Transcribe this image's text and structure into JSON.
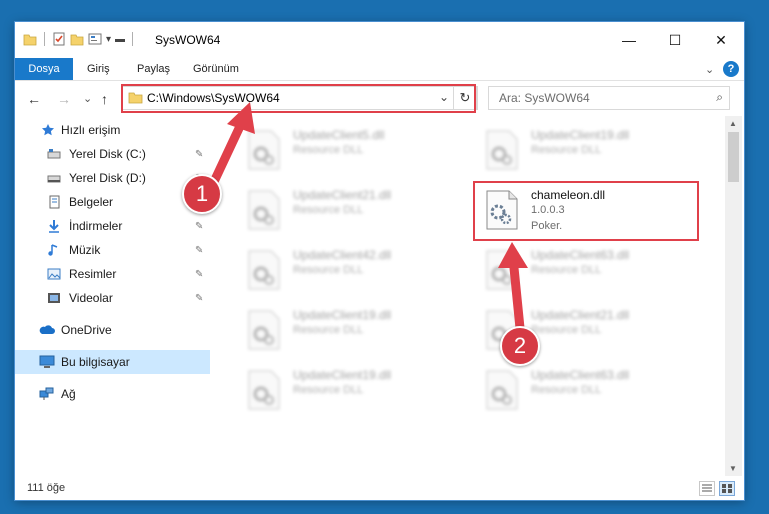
{
  "window": {
    "title": "SysWOW64",
    "qat_dropdown": "▾",
    "controls": {
      "minimize": "—",
      "maximize": "☐",
      "close": "✕"
    }
  },
  "ribbon": {
    "tabs": [
      "Dosya",
      "Giriş",
      "Paylaş",
      "Görünüm"
    ],
    "collapse": "⌄",
    "help": "?"
  },
  "navbar": {
    "back": "←",
    "forward": "→",
    "recent": "⌄",
    "up": "↑",
    "address": "C:\\Windows\\SysWOW64",
    "address_dropdown": "⌄",
    "refresh": "↻",
    "search_placeholder": "Ara: SysWOW64",
    "search_icon": "⌕"
  },
  "sidebar": {
    "items": [
      {
        "label": "Hızlı erişim",
        "icon": "star-icon",
        "pinned": false
      },
      {
        "label": "Yerel Disk (C:)",
        "icon": "drive-icon",
        "pinned": true
      },
      {
        "label": "Yerel Disk (D:)",
        "icon": "drive-icon",
        "pinned": true
      },
      {
        "label": "Belgeler",
        "icon": "documents-icon",
        "pinned": true
      },
      {
        "label": "İndirmeler",
        "icon": "download-icon",
        "pinned": true
      },
      {
        "label": "Müzik",
        "icon": "music-icon",
        "pinned": true
      },
      {
        "label": "Resimler",
        "icon": "pictures-icon",
        "pinned": true
      },
      {
        "label": "Videolar",
        "icon": "video-icon",
        "pinned": true
      },
      {
        "label": "OneDrive",
        "icon": "cloud-icon",
        "pinned": false
      },
      {
        "label": "Bu bilgisayar",
        "icon": "computer-icon",
        "pinned": false,
        "selected": true
      },
      {
        "label": "Ağ",
        "icon": "network-icon",
        "pinned": false
      }
    ],
    "pin_glyph": "📌"
  },
  "files": [
    {
      "name": "UpdateClient5.dll",
      "desc": "Resource DLL",
      "blurred": true
    },
    {
      "name": "UpdateClient19.dll",
      "desc": "Resource DLL",
      "blurred": true
    },
    {
      "name": "UpdateClient21.dll",
      "desc": "Resource DLL",
      "blurred": true
    },
    {
      "name": "chameleon.dll",
      "version": "1.0.0.3",
      "desc": "Poker.",
      "blurred": false
    },
    {
      "name": "UpdateClient42.dll",
      "desc": "Resource DLL",
      "blurred": true
    },
    {
      "name": "UpdateClient63.dll",
      "desc": "Resource DLL",
      "blurred": true
    },
    {
      "name": "UpdateClient19.dll",
      "desc": "Resource DLL",
      "blurred": true
    },
    {
      "name": "UpdateClient21.dll",
      "desc": "Resource DLL",
      "blurred": true
    },
    {
      "name": "UpdateClient19.dll",
      "desc": "Resource DLL",
      "blurred": true
    },
    {
      "name": "UpdateClient63.dll",
      "desc": "Resource DLL",
      "blurred": true
    }
  ],
  "status": {
    "count": "111 öğe"
  },
  "annotations": {
    "step1": "1",
    "step2": "2",
    "color": "#e0404a"
  },
  "colors": {
    "accent": "#1979ca",
    "selected": "#cce8ff",
    "annotation": "#d63a44"
  }
}
